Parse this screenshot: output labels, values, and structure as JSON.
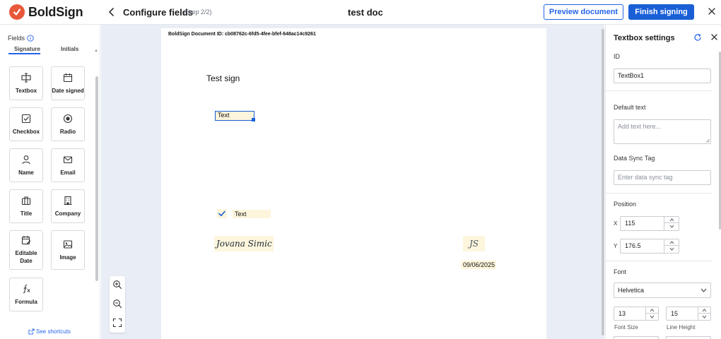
{
  "app": {
    "logo_text": "BoldSign",
    "brand_color": "#e8583a",
    "accent": "#1a5fd6"
  },
  "header": {
    "title": "Configure fields",
    "step": "(Step 2/2)",
    "document_name": "test doc",
    "preview_label": "Preview document",
    "finish_label": "Finish signing"
  },
  "left_panel": {
    "fields_label": "Fields",
    "tabs": [
      "Signature",
      "Initials"
    ],
    "tiles": [
      {
        "label": "Textbox",
        "icon": "textbox-icon"
      },
      {
        "label": "Date signed",
        "icon": "calendar-icon"
      },
      {
        "label": "Checkbox",
        "icon": "checkbox-icon"
      },
      {
        "label": "Radio",
        "icon": "radio-icon"
      },
      {
        "label": "Name",
        "icon": "person-icon"
      },
      {
        "label": "Email",
        "icon": "envelope-icon"
      },
      {
        "label": "Title",
        "icon": "briefcase-icon"
      },
      {
        "label": "Company",
        "icon": "building-icon"
      },
      {
        "label": "Editable Date",
        "icon": "edit-calendar-icon"
      },
      {
        "label": "Image",
        "icon": "image-icon"
      },
      {
        "label": "Formula",
        "icon": "function-icon"
      }
    ],
    "shortcuts_label": "See shortcuts"
  },
  "document": {
    "doc_id": "BoldSign Document ID: cb08762c-6fd5-4fee-bfef-648ac14c9261",
    "heading": "Test sign",
    "text_field": "Text",
    "checkbox_checked": true,
    "checkbox_text": "Text",
    "signature": "Jovana Simic",
    "initials": "JS",
    "date": "09/06/2025"
  },
  "settings": {
    "title": "Textbox settings",
    "id_label": "ID",
    "id_value": "TextBox1",
    "default_text_label": "Default text",
    "default_text_placeholder": "Add text here...",
    "data_sync_label": "Data Sync Tag",
    "data_sync_placeholder": "Enter data sync tag",
    "position_label": "Position",
    "x_label": "X",
    "x_value": "115",
    "y_label": "Y",
    "y_value": "176.5",
    "font_label": "Font",
    "font_value": "Helvetica",
    "font_size": "13",
    "font_size_label": "Font Size",
    "line_height": "15",
    "line_height_label": "Line Height"
  }
}
